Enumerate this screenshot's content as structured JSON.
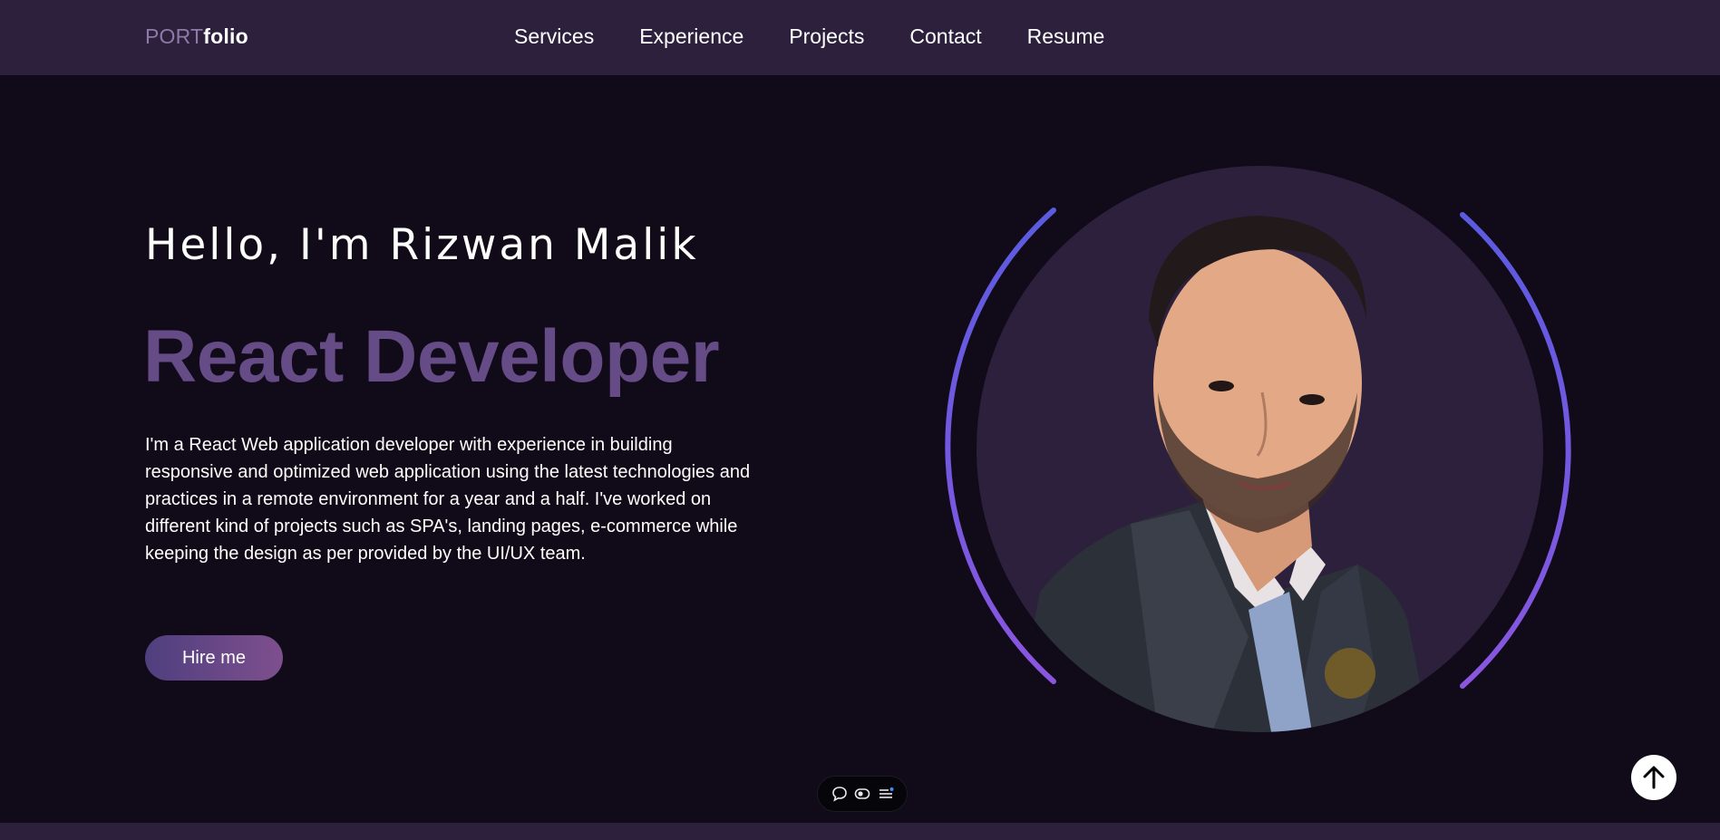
{
  "navbar": {
    "logo_part1": "PORT",
    "logo_part2": "folio",
    "links": [
      "Services",
      "Experience",
      "Projects",
      "Contact",
      "Resume"
    ]
  },
  "hero": {
    "greeting": "Hello, I'm Rizwan Malik",
    "role": "React Developer",
    "bio": "I'm a React Web application developer with experience in building responsive and optimized web application using the latest technologies and practices in a remote environment for a year and a half. I've worked on different kind of projects such as SPA's, landing pages, e-commerce while keeping the design as per provided by the UI/UX team.",
    "cta_label": "Hire me"
  },
  "toolbar": {
    "icons": [
      "comment-icon",
      "toggle-icon",
      "list-icon"
    ]
  },
  "scroll_top_icon": "arrow-up-icon",
  "colors": {
    "background": "#110b19",
    "navbar": "#2c203d",
    "accent_purple": "#654c86",
    "ring_gradient_start": "#5b5be0",
    "ring_gradient_end": "#8a56e0"
  }
}
